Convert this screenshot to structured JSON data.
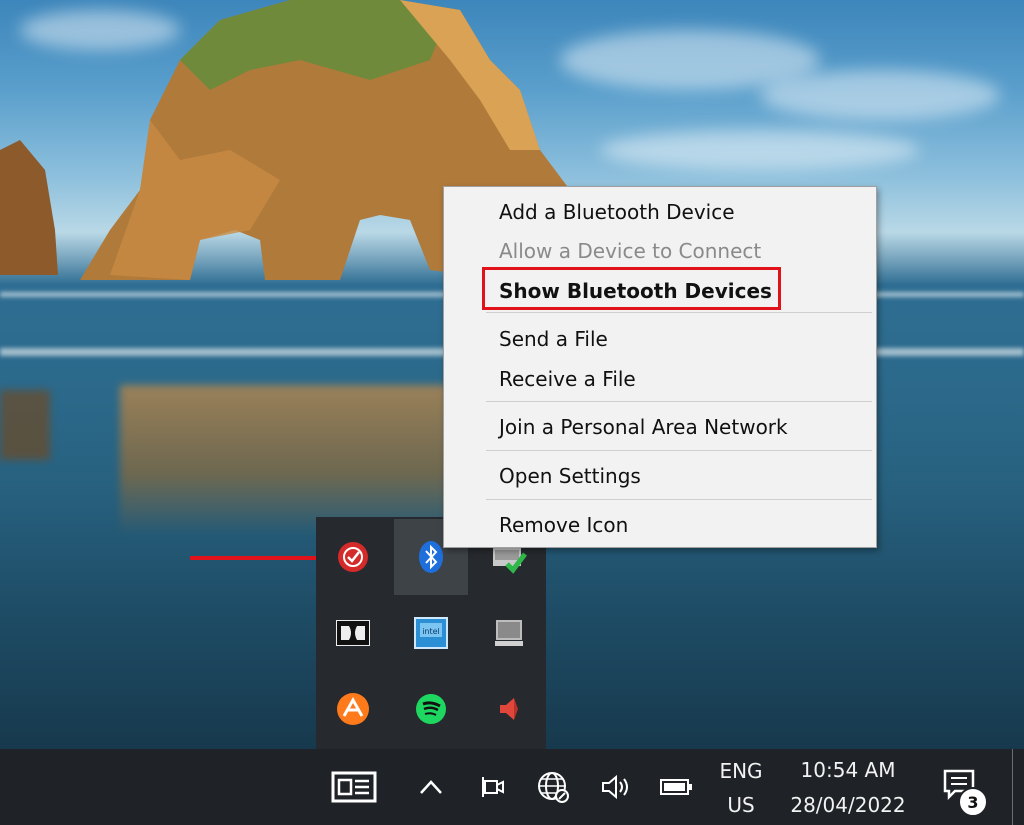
{
  "context_menu": {
    "items": [
      {
        "label": "Add a Bluetooth Device",
        "enabled": true,
        "bold": false
      },
      {
        "label": "Allow a Device to Connect",
        "enabled": false,
        "bold": false
      },
      {
        "label": "Show Bluetooth Devices",
        "enabled": true,
        "bold": true,
        "highlighted": true
      },
      {
        "label": "Send a File",
        "enabled": true,
        "bold": false
      },
      {
        "label": "Receive a File",
        "enabled": true,
        "bold": false
      },
      {
        "label": "Join a Personal Area Network",
        "enabled": true,
        "bold": false
      },
      {
        "label": "Open Settings",
        "enabled": true,
        "bold": false
      },
      {
        "label": "Remove Icon",
        "enabled": true,
        "bold": false
      }
    ]
  },
  "tray_overflow": {
    "icons": [
      "security-shield-icon",
      "bluetooth-icon",
      "network-check-icon",
      "dolby-icon",
      "intel-graphics-icon",
      "tablet-display-icon",
      "avast-icon",
      "spotify-icon",
      "speaker-red-icon"
    ],
    "hovered": "bluetooth-icon"
  },
  "taskbar": {
    "icons": [
      "news-widget-icon",
      "show-hidden-icons-chevron",
      "meet-now-icon",
      "network-globe-icon",
      "volume-icon",
      "battery-icon",
      "notifications-icon"
    ],
    "language": "ENG",
    "region": "US",
    "time": "10:54 AM",
    "date": "28/04/2022",
    "notification_count": "3"
  },
  "colors": {
    "highlight_border": "#e2121b",
    "annotation_arrow": "#e2121b",
    "taskbar_bg": "#1f2327",
    "menu_bg": "#f2f2f2",
    "bluetooth_blue": "#1e6fdc"
  }
}
